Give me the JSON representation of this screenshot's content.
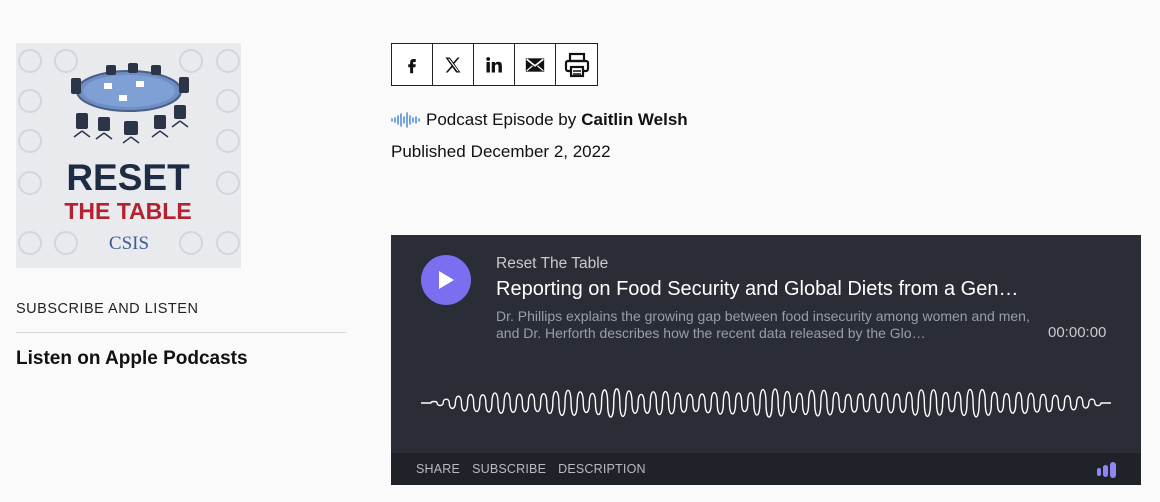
{
  "cover": {
    "title_line1": "RESET",
    "title_line2": "THE TABLE",
    "publisher": "CSIS",
    "accent_navy": "#1f2a44",
    "accent_red": "#b3232f"
  },
  "sidebar": {
    "subscribe_heading": "SUBSCRIBE AND LISTEN",
    "apple_link": "Listen on Apple Podcasts"
  },
  "share": {
    "buttons": [
      {
        "icon": "facebook-icon"
      },
      {
        "icon": "x-twitter-icon"
      },
      {
        "icon": "linkedin-icon"
      },
      {
        "icon": "email-icon"
      },
      {
        "icon": "print-icon"
      }
    ]
  },
  "meta": {
    "byline_prefix": "Podcast Episode by",
    "author": "Caitlin Welsh",
    "published_label": "Published",
    "published_date": "December 2, 2022"
  },
  "player": {
    "show_name": "Reset The Table",
    "episode_title": "Reporting on Food Security and Global Diets from a Gen…",
    "description": "Dr. Phillips explains the growing gap between food insecurity among women and men, and Dr. Herforth describes how the recent data released by the Glo…",
    "timecode": "00:00:00",
    "footer": {
      "share": "SHARE",
      "subscribe": "SUBSCRIBE",
      "description": "DESCRIPTION"
    },
    "colors": {
      "background": "#2a2d35",
      "play_button": "#7b6ef0"
    }
  }
}
